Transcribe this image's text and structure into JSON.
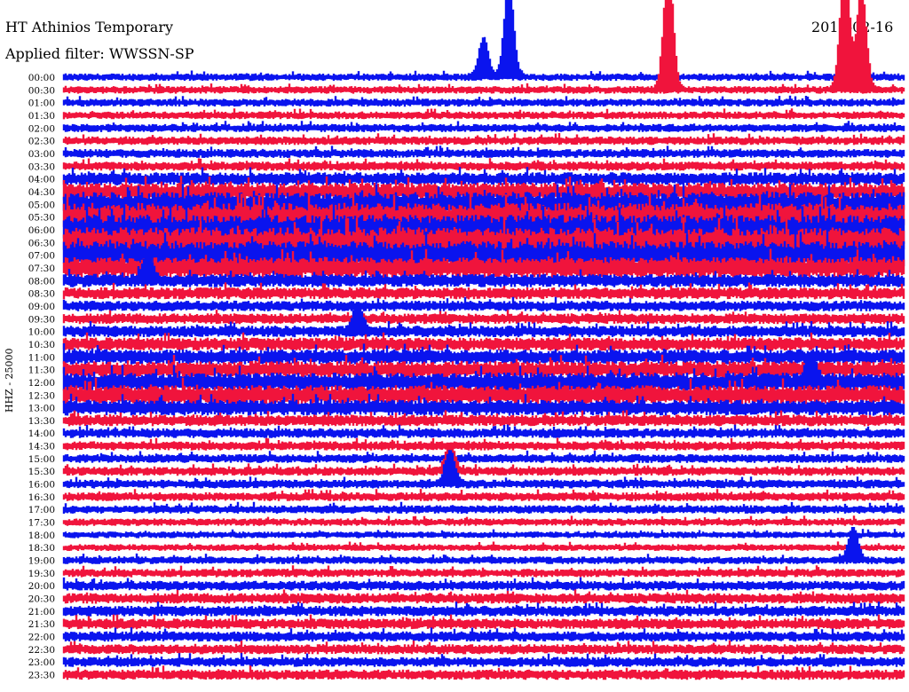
{
  "chart_data": {
    "type": "seismogram",
    "title": "HT Athinios Temporary",
    "date": "2012-02-16",
    "subtitle": "Applied filter: WWSSN-SP",
    "ylabel": "HHZ - 25000",
    "colors": {
      "blue": "#0a14ee",
      "red": "#f0143c"
    },
    "rows": [
      "00:00",
      "00:30",
      "01:00",
      "01:30",
      "02:00",
      "02:30",
      "03:00",
      "03:30",
      "04:00",
      "04:30",
      "05:00",
      "05:30",
      "06:00",
      "06:30",
      "07:00",
      "07:30",
      "08:00",
      "08:30",
      "09:00",
      "09:30",
      "10:00",
      "10:30",
      "11:00",
      "11:30",
      "12:00",
      "12:30",
      "13:00",
      "13:30",
      "14:00",
      "14:30",
      "15:00",
      "15:30",
      "16:00",
      "16:30",
      "17:00",
      "17:30",
      "18:00",
      "18:30",
      "19:00",
      "19:30",
      "20:00",
      "20:30",
      "21:00",
      "21:30",
      "22:00",
      "22:30",
      "23:00",
      "23:30"
    ],
    "band_height": [
      4.2,
      4.3,
      4.5,
      4.4,
      4.6,
      4.8,
      5.0,
      5.2,
      7.5,
      10,
      14,
      16,
      17,
      17,
      16,
      12,
      7.5,
      6.8,
      6.0,
      6.0,
      6.5,
      7.5,
      8.5,
      9.5,
      11,
      11,
      9.0,
      6.5,
      5.5,
      5.2,
      5.0,
      5.0,
      5.0,
      5.0,
      4.8,
      4.2,
      3.8,
      3.8,
      4.3,
      4.8,
      5.5,
      6.0,
      6.0,
      6.0,
      5.8,
      5.6,
      5.6,
      5.8
    ],
    "events": [
      {
        "row": "00:00",
        "time": 0.5,
        "amplitude": 3.0
      },
      {
        "row": "00:00",
        "time": 0.53,
        "amplitude": 7.5
      },
      {
        "row": "00:30",
        "time": 0.72,
        "amplitude": 10.0
      },
      {
        "row": "00:30",
        "time": 0.93,
        "amplitude": 10.0
      },
      {
        "row": "00:30",
        "time": 0.95,
        "amplitude": 8.0
      },
      {
        "row": "08:00",
        "time": 0.1,
        "amplitude": 1.8
      },
      {
        "row": "10:00",
        "time": 0.35,
        "amplitude": 2.0
      },
      {
        "row": "12:00",
        "time": 0.89,
        "amplitude": 2.0
      },
      {
        "row": "15:30",
        "time": 0.46,
        "amplitude": 2.0
      },
      {
        "row": "16:00",
        "time": 0.46,
        "amplitude": 2.5
      },
      {
        "row": "19:00",
        "time": 0.94,
        "amplitude": 2.5
      }
    ]
  }
}
